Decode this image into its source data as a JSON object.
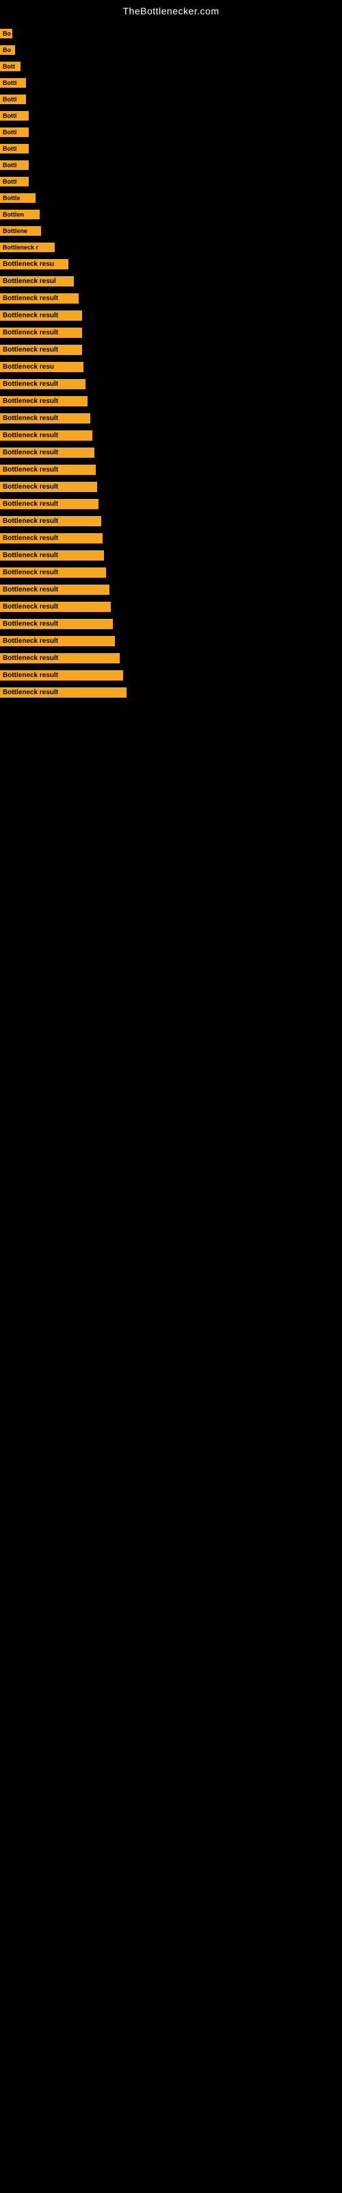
{
  "site": {
    "title": "TheBottlenecker.com"
  },
  "items": [
    {
      "id": 1,
      "label": "Bo"
    },
    {
      "id": 2,
      "label": "Bo"
    },
    {
      "id": 3,
      "label": "Bott"
    },
    {
      "id": 4,
      "label": "Bottl"
    },
    {
      "id": 5,
      "label": "Bottl"
    },
    {
      "id": 6,
      "label": "Bottl"
    },
    {
      "id": 7,
      "label": "Bottl"
    },
    {
      "id": 8,
      "label": "Bottl"
    },
    {
      "id": 9,
      "label": "Bottl"
    },
    {
      "id": 10,
      "label": "Bottl"
    },
    {
      "id": 11,
      "label": "Bottle"
    },
    {
      "id": 12,
      "label": "Bottlen"
    },
    {
      "id": 13,
      "label": "Bottlene"
    },
    {
      "id": 14,
      "label": "Bottleneck r"
    },
    {
      "id": 15,
      "label": "Bottleneck resu"
    },
    {
      "id": 16,
      "label": "Bottleneck resul"
    },
    {
      "id": 17,
      "label": "Bottleneck result"
    },
    {
      "id": 18,
      "label": "Bottleneck result"
    },
    {
      "id": 19,
      "label": "Bottleneck result"
    },
    {
      "id": 20,
      "label": "Bottleneck result"
    },
    {
      "id": 21,
      "label": "Bottleneck resu"
    },
    {
      "id": 22,
      "label": "Bottleneck result"
    },
    {
      "id": 23,
      "label": "Bottleneck result"
    },
    {
      "id": 24,
      "label": "Bottleneck result"
    },
    {
      "id": 25,
      "label": "Bottleneck result"
    },
    {
      "id": 26,
      "label": "Bottleneck result"
    },
    {
      "id": 27,
      "label": "Bottleneck result"
    },
    {
      "id": 28,
      "label": "Bottleneck result"
    },
    {
      "id": 29,
      "label": "Bottleneck result"
    },
    {
      "id": 30,
      "label": "Bottleneck result"
    },
    {
      "id": 31,
      "label": "Bottleneck result"
    },
    {
      "id": 32,
      "label": "Bottleneck result"
    },
    {
      "id": 33,
      "label": "Bottleneck result"
    },
    {
      "id": 34,
      "label": "Bottleneck result"
    },
    {
      "id": 35,
      "label": "Bottleneck result"
    },
    {
      "id": 36,
      "label": "Bottleneck result"
    },
    {
      "id": 37,
      "label": "Bottleneck result"
    },
    {
      "id": 38,
      "label": "Bottleneck result"
    },
    {
      "id": 39,
      "label": "Bottleneck result"
    },
    {
      "id": 40,
      "label": "Bottleneck result"
    }
  ]
}
